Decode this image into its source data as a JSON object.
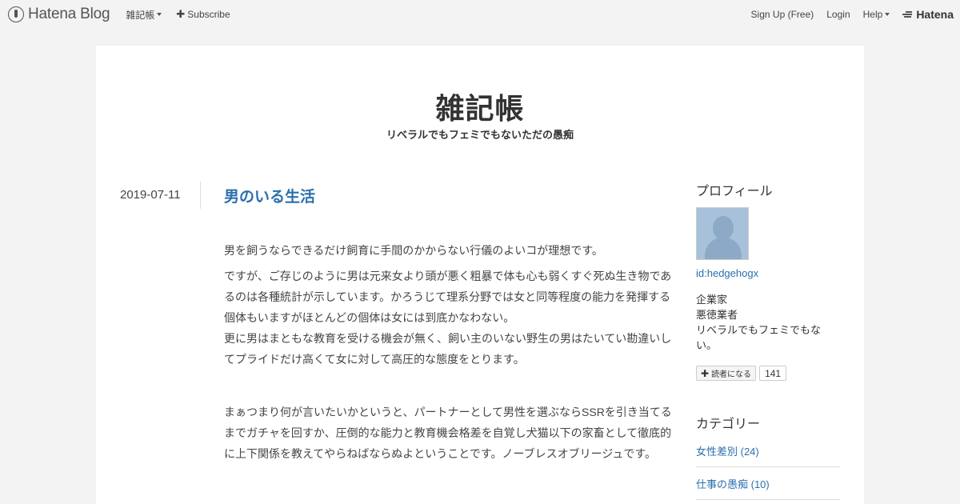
{
  "global_header": {
    "brand": "Hatena Blog",
    "blog_menu": "雑記帳",
    "subscribe": "Subscribe",
    "signup": "Sign Up (Free)",
    "login": "Login",
    "help": "Help",
    "hatena": "Hatena"
  },
  "blog": {
    "title": "雑記帳",
    "description": "リベラルでもフェミでもないただの愚痴"
  },
  "entry": {
    "date": "2019-07-11",
    "title": "男のいる生活",
    "paragraphs": [
      "男を飼うならできるだけ飼育に手間のかからない行儀のよいコが理想です。",
      "ですが、ご存じのように男は元来女より頭が悪く粗暴で体も心も弱くすぐ死ぬ生き物であるのは各種統計が示しています。かろうじて理系分野では女と同等程度の能力を発揮する個体もいますがほとんどの個体は女には到底かなわない。",
      "更に男はまともな教育を受ける機会が無く、飼い主のいない野生の男はたいてい勘違いしてプライドだけ高くて女に対して高圧的な態度をとります。"
    ],
    "para4_before": "まぁつまり何が言いたいかというと、パートナーとして男性を選ぶならSSRを引き当てるまでガチャを回すか、圧倒的な能力と教育機会格差を自覚し犬猫以下の家畜として徹底的に上下関係を教えてやらねばならぬよということです。ノーブレスオブリージュです。"
  },
  "sidebar": {
    "profile_heading": "プロフィール",
    "profile_id": "id:hedgehogx",
    "profile_lines": [
      "企業家",
      "悪徳業者",
      "リベラルでもフェミでもない。"
    ],
    "subscribe_label": "読者になる",
    "subscriber_count": "141",
    "category_heading": "カテゴリー",
    "categories": [
      "女性差別 (24)",
      "仕事の愚痴 (10)"
    ]
  },
  "colors": {
    "link": "#2b6fad",
    "background": "#f3f3f3",
    "card": "#ffffff"
  }
}
